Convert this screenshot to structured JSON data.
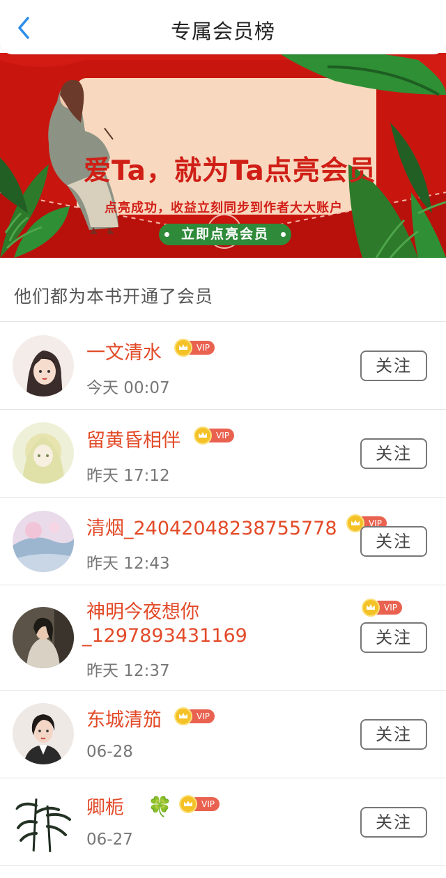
{
  "header": {
    "back_icon": "chevron-left-icon",
    "title": "专属会员榜"
  },
  "banner": {
    "headline": "爱Ta，就为Ta点亮会员",
    "subtitle": "点亮成功，收益立刻同步到作者大大账户",
    "button_label": "立即点亮会员",
    "colors": {
      "background": "#c8160f",
      "card": "#f8d9c0",
      "headline": "#cf1f16",
      "button": "#2f8a3a"
    }
  },
  "section": {
    "title": "他们都为本书开通了会员"
  },
  "members": [
    {
      "name": "一文清水",
      "time": "今天 00:07",
      "badge": "VIP",
      "follow_label": "关注"
    },
    {
      "name": "留黄昏相伴",
      "time": "昨天 17:12",
      "badge": "VIP",
      "follow_label": "关注"
    },
    {
      "name": "清烟_24042048238755778",
      "time": "昨天 12:43",
      "badge": "VIP",
      "follow_label": "关注"
    },
    {
      "name_line1": "神明今夜想你",
      "name_line2": "_1297893431169",
      "time": "昨天 12:37",
      "badge": "VIP",
      "follow_label": "关注"
    },
    {
      "name": "东城清笳",
      "time": "06-28",
      "badge": "VIP",
      "follow_label": "关注"
    },
    {
      "name": "卿栀",
      "name_icon": "🍀",
      "time": "06-27",
      "badge": "VIP",
      "follow_label": "关注"
    }
  ],
  "colors": {
    "name": "#e24a28",
    "vip_pill": "#e96250",
    "vip_crown": "#f4c227",
    "divider": "#e3e3e3"
  }
}
